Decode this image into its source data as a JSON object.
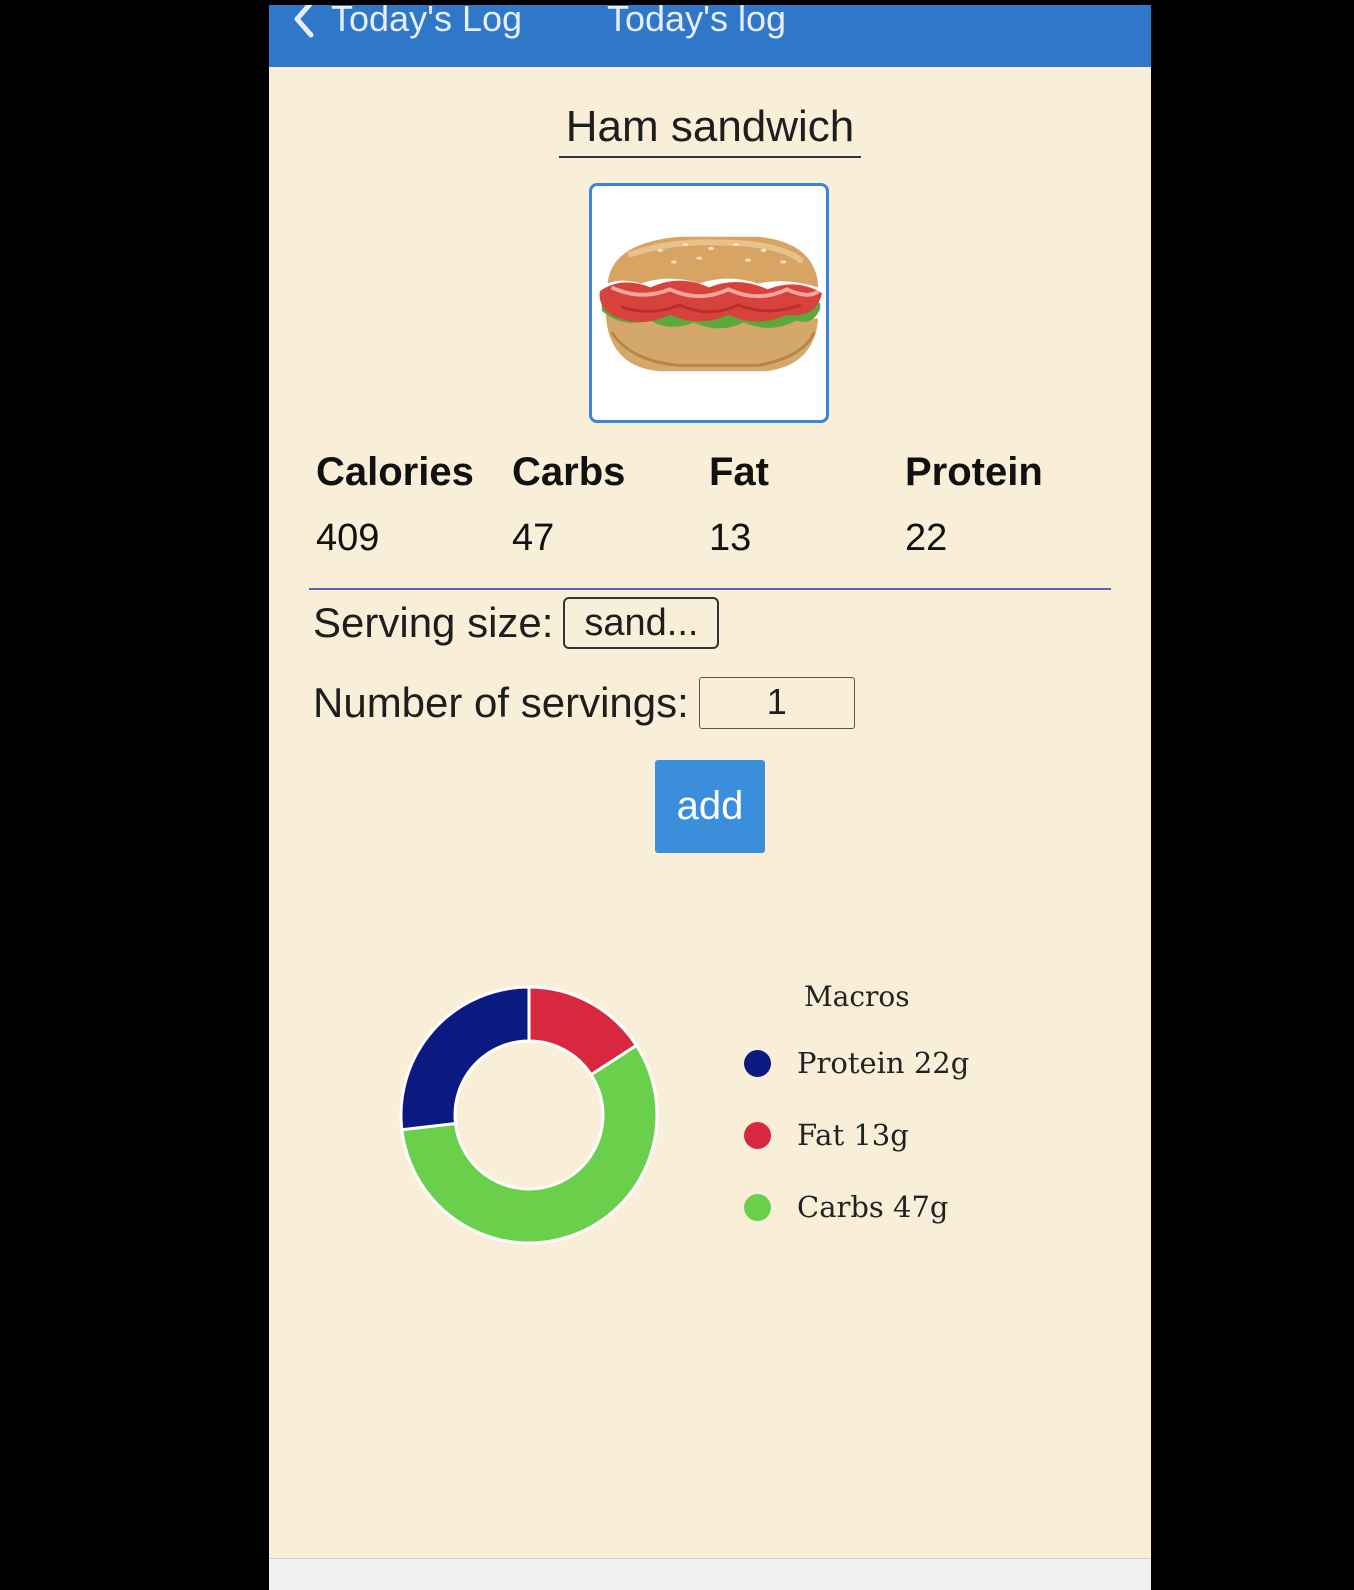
{
  "navbar": {
    "back_label": "Today's Log",
    "title": "Today's log",
    "color": "#2f77c8"
  },
  "food": {
    "name": "Ham sandwich",
    "image_icon": "ham-sandwich-image"
  },
  "macros_table": {
    "headers": [
      "Calories",
      "Carbs",
      "Fat",
      "Protein"
    ],
    "values": [
      "409",
      "47",
      "13",
      "22"
    ]
  },
  "serving": {
    "size_label": "Serving size:",
    "size_value": "sand...",
    "count_label": "Number of servings:",
    "count_value": "1"
  },
  "actions": {
    "add_label": "add",
    "add_color": "#3a8edc"
  },
  "chart_data": {
    "type": "pie",
    "style": "donut",
    "title": "Macros",
    "legend_position": "right",
    "series": [
      {
        "name": "Protein",
        "value": 22,
        "unit": "g",
        "label": "Protein 22g",
        "color": "#0a1a80"
      },
      {
        "name": "Fat",
        "value": 13,
        "unit": "g",
        "label": "Fat 13g",
        "color": "#d8283f"
      },
      {
        "name": "Carbs",
        "value": 47,
        "unit": "g",
        "label": "Carbs 47g",
        "color": "#6ad04c"
      }
    ]
  }
}
